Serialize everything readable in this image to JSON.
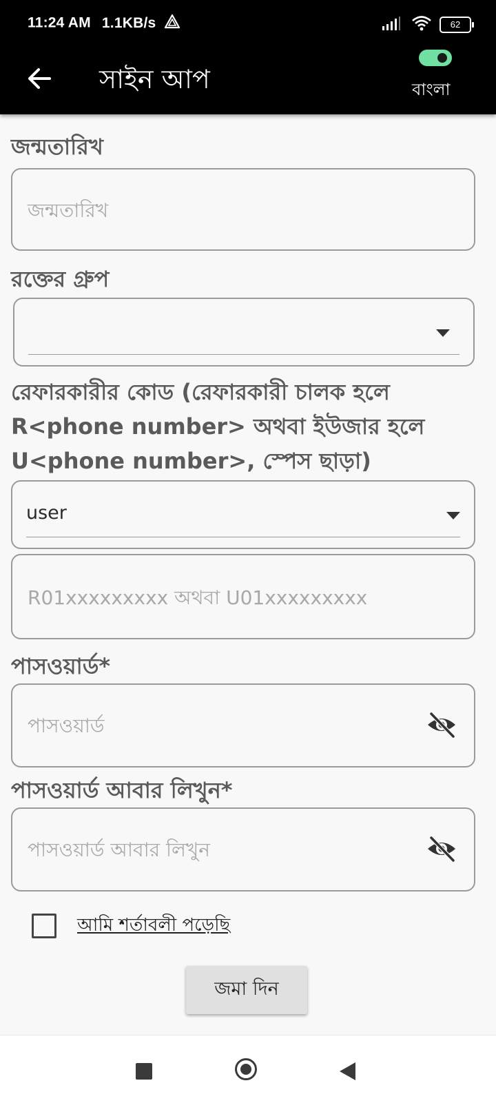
{
  "status_bar": {
    "time": "11:24 AM",
    "speed": "1.1KB/s",
    "battery": "62",
    "icons": [
      "alert-triangle-icon",
      "signal-icon",
      "wifi-icon",
      "battery-icon"
    ]
  },
  "app_bar": {
    "title": "সাইন আপ",
    "back_icon": "arrow-left-icon",
    "language_label": "বাংলা",
    "language_toggle_on": true,
    "toggle_color": "#6fe0a1"
  },
  "form": {
    "dob": {
      "label": "জন্মতারিখ",
      "placeholder": "জন্মতারিখ"
    },
    "blood_group": {
      "label": "রক্তের গ্রুপ",
      "value": ""
    },
    "referral": {
      "label": "রেফারকারীর কোড (রেফারকারী চালক হলে R<phone number> অথবা ইউজার হলে U<phone number>, স্পেস ছাড়া)",
      "type_value": "user",
      "placeholder": "R01xxxxxxxxx অথবা U01xxxxxxxxx"
    },
    "password": {
      "label": "পাসওয়ার্ড*",
      "placeholder": "পাসওয়ার্ড",
      "icon": "eye-off-icon"
    },
    "confirm_password": {
      "label": "পাসওয়ার্ড আবার লিখুন*",
      "placeholder": "পাসওয়ার্ড আবার লিখুন",
      "icon": "eye-off-icon"
    },
    "terms": {
      "label": "আমি শর্তাবলী পড়েছি",
      "checked": false
    },
    "submit_label": "জমা দিন"
  },
  "nav_bar": {
    "icons": [
      "recents-square-icon",
      "home-circle-icon",
      "back-triangle-icon"
    ]
  }
}
